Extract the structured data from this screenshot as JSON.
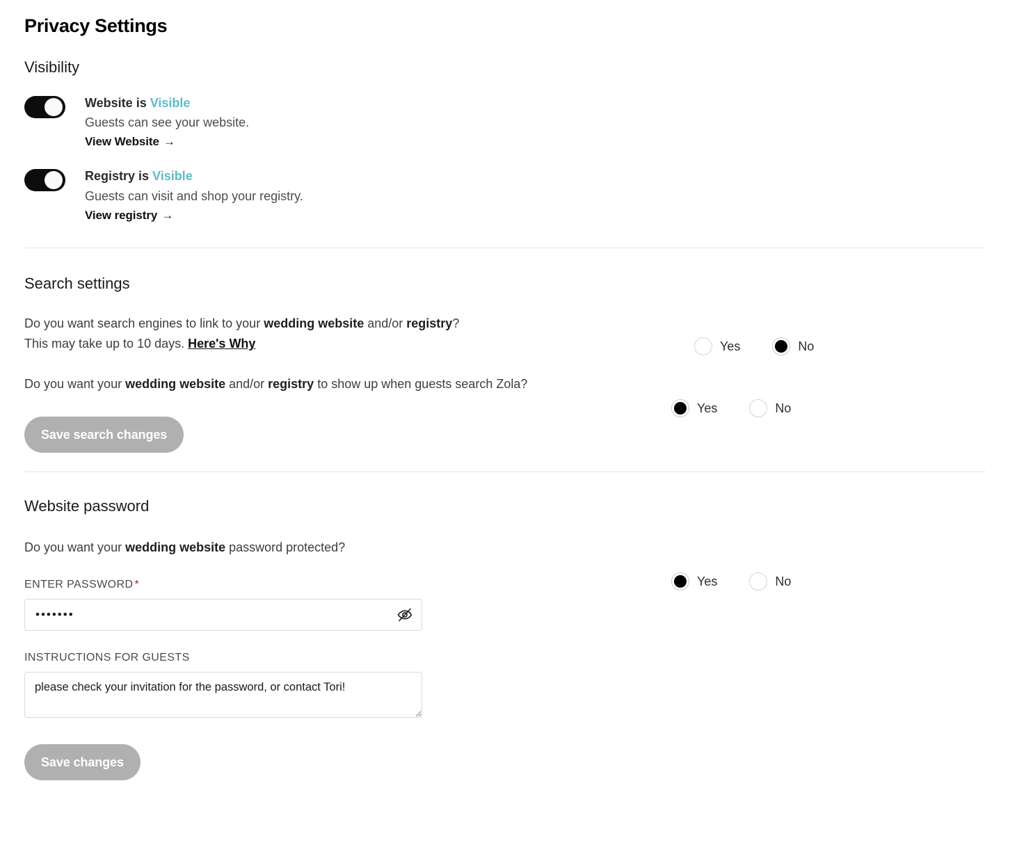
{
  "page": {
    "title": "Privacy Settings"
  },
  "visibility": {
    "heading": "Visibility",
    "items": [
      {
        "status_prefix": "Website is ",
        "status_state": "Visible",
        "description": "Guests can see your website.",
        "link_label": "View Website",
        "link_arrow": "→",
        "toggle_on": true
      },
      {
        "status_prefix": "Registry is ",
        "status_state": "Visible",
        "description": "Guests can visit and shop your registry.",
        "link_label": "View registry",
        "link_arrow": "→",
        "toggle_on": true
      }
    ]
  },
  "search_settings": {
    "heading": "Search settings",
    "questions": [
      {
        "line1_a": "Do you want search engines to link to your ",
        "line1_b": "wedding website",
        "line1_c": " and/or ",
        "line1_d": "registry",
        "line1_e": "?",
        "line2_a": "This may take up to 10 days. ",
        "line2_link": "Here's Why",
        "yes_label": "Yes",
        "no_label": "No",
        "selected": "No"
      },
      {
        "line1_a": "Do you want your ",
        "line1_b": "wedding website",
        "line1_c": " and/or ",
        "line1_d": "registry",
        "line1_e": " to show up when guests search Zola?",
        "yes_label": "Yes",
        "no_label": "No",
        "selected": "Yes"
      }
    ],
    "save_label": "Save search changes"
  },
  "website_password": {
    "heading": "Website password",
    "question": {
      "line1_a": "Do you want your ",
      "line1_b": "wedding website",
      "line1_c": " password protected?",
      "yes_label": "Yes",
      "no_label": "No",
      "selected": "Yes"
    },
    "password_label": "ENTER PASSWORD",
    "required_mark": "*",
    "password_value": "•••••••",
    "password_placeholder": "",
    "instructions_label": "INSTRUCTIONS FOR GUESTS",
    "instructions_value": "please check your invitation for the password, or contact Tori!",
    "instructions_placeholder": "",
    "save_label": "Save changes"
  },
  "icons": {
    "eye_off": "eye-off-icon"
  },
  "colors": {
    "accent_teal": "#5bbcc6",
    "required_red": "#c8102e",
    "toggle_on": "#0d0d0d",
    "button_disabled": "#b0b0b0",
    "divider": "#e6e6e6"
  }
}
